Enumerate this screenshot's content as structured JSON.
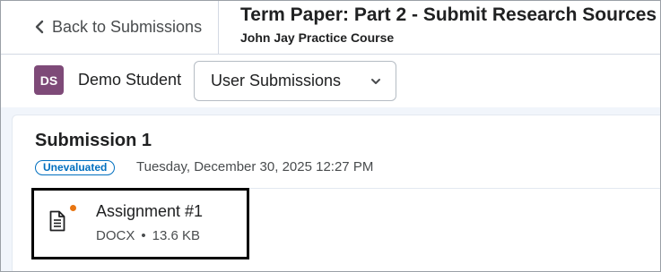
{
  "header": {
    "back_label": "Back to Submissions",
    "title": "Term Paper: Part 2 - Submit Research Sources",
    "course": "John Jay Practice Course"
  },
  "student": {
    "initials": "DS",
    "name": "Demo Student",
    "avatar_color": "#7e4a78"
  },
  "view_select": {
    "selected": "User Submissions"
  },
  "submission": {
    "heading": "Submission 1",
    "status": "Unevaluated",
    "date": "Tuesday, December 30, 2025 12:27 PM",
    "file": {
      "name": "Assignment #1",
      "type": "DOCX",
      "separator": "•",
      "size": "13.6 KB",
      "icon": "document-icon",
      "unread_dot_color": "#e87511"
    }
  }
}
